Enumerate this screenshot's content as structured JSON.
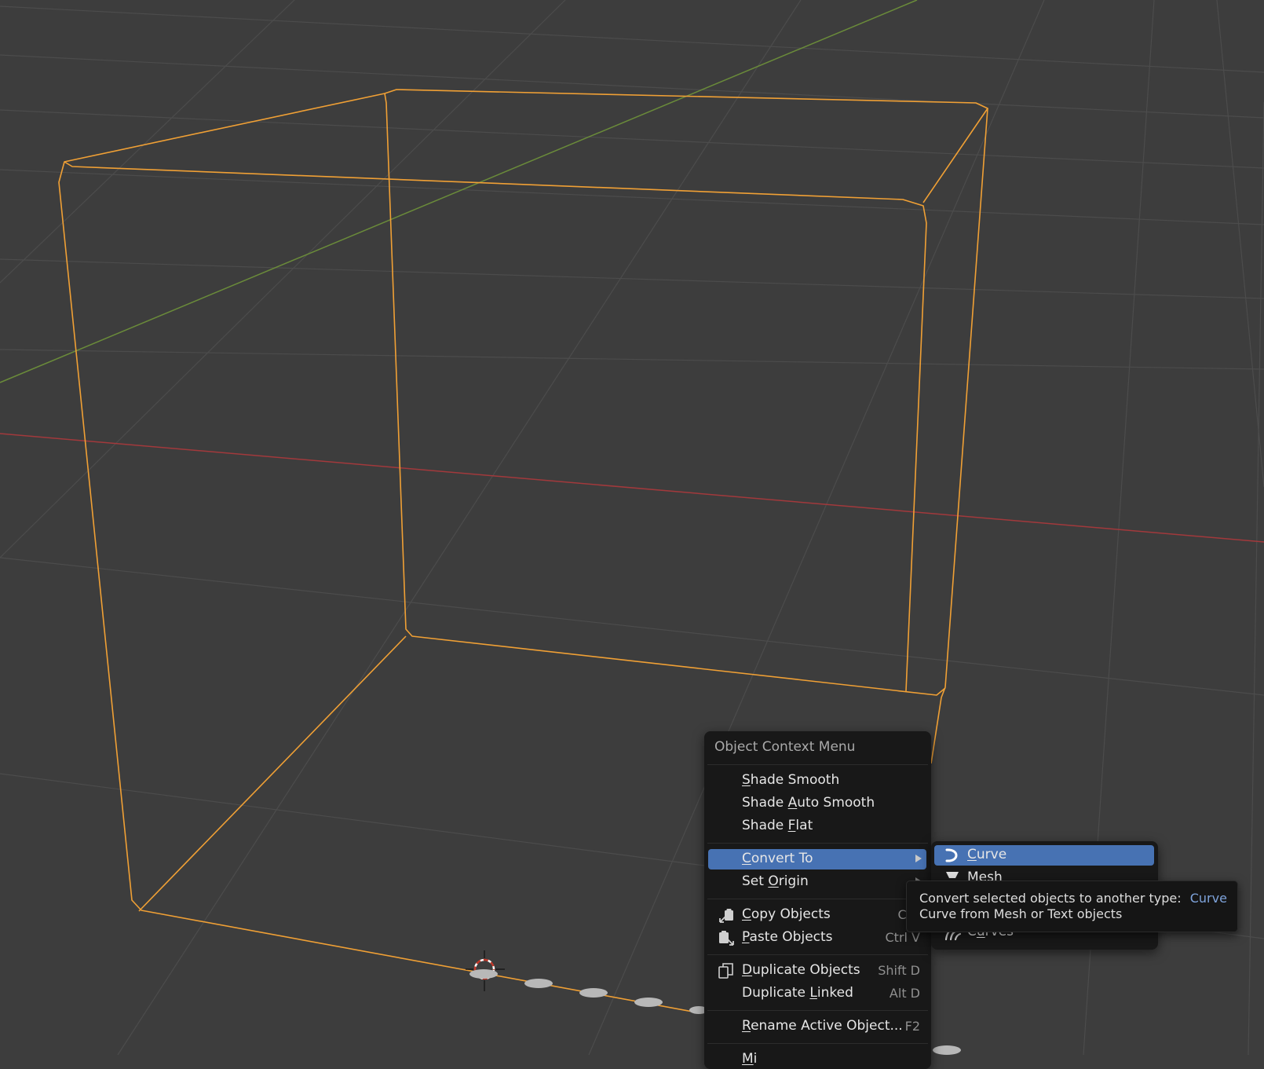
{
  "viewport": {
    "colors": {
      "background": "#3d3d3d",
      "grid": "#4b4b4b",
      "x_axis": "#a2393c",
      "y_axis": "#6a8b3a",
      "selection_outline": "#f0a035"
    }
  },
  "context_menu": {
    "title": "Object Context Menu",
    "items": [
      {
        "label": "Shade Smooth",
        "mnemonic_index": 0,
        "shortcut": ""
      },
      {
        "label": "Shade Auto Smooth",
        "mnemonic_index": 6,
        "shortcut": ""
      },
      {
        "label": "Shade Flat",
        "mnemonic_index": 6,
        "shortcut": ""
      },
      {
        "label": "Convert To",
        "mnemonic_index": 0,
        "shortcut": "",
        "submenu": true,
        "active": true
      },
      {
        "label": "Set Origin",
        "mnemonic_index": 4,
        "shortcut": "",
        "submenu": true
      },
      {
        "label": "Copy Objects",
        "mnemonic_index": 0,
        "shortcut": "Ctrl",
        "icon": "copy-icon"
      },
      {
        "label": "Paste Objects",
        "mnemonic_index": 0,
        "shortcut": "Ctrl V",
        "icon": "paste-icon"
      },
      {
        "label": "Duplicate Objects",
        "mnemonic_index": 0,
        "shortcut": "Shift D",
        "icon": "duplicate-icon"
      },
      {
        "label": "Duplicate Linked",
        "mnemonic_index": 10,
        "shortcut": "Alt D"
      },
      {
        "label": "Rename Active Object...",
        "mnemonic_index": 0,
        "shortcut": "F2"
      },
      {
        "label": "Mi",
        "mnemonic_index": 0,
        "shortcut": ""
      }
    ]
  },
  "convert_submenu": {
    "items": [
      {
        "label": "Curve",
        "mnemonic_index": 0,
        "icon": "curve-icon",
        "active": true
      },
      {
        "label": "Mesh",
        "mnemonic_index": 0,
        "icon": "mesh-icon"
      },
      {
        "label": "Curves",
        "mnemonic_index": 1,
        "icon": "curves-icon"
      }
    ]
  },
  "tooltip": {
    "line1_prefix": "Convert selected objects to another type:",
    "line1_value": "Curve",
    "line2": "Curve from Mesh or Text objects"
  }
}
